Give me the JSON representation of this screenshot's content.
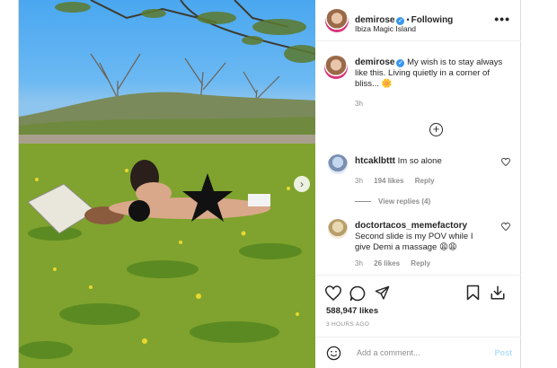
{
  "post": {
    "username": "demirose",
    "following_label": "Following",
    "location": "Ibiza Magic Island",
    "more_icon": "more-horizontal-icon"
  },
  "caption": {
    "username": "demirose",
    "text": "My wish is to stay always like this. Living quietly in a corner of bliss...",
    "emoji": "🌼",
    "time": "3h"
  },
  "comments": [
    {
      "username": "htcaklbttt",
      "text": "Im so alone",
      "time": "3h",
      "likes": "194 likes",
      "reply": "Reply",
      "view_replies": "View replies (4)"
    },
    {
      "username": "doctortacos_memefactory",
      "text": "Second slide is my POV while I give Demi a massage 😩😩",
      "time": "3h",
      "likes": "26 likes",
      "reply": "Reply"
    }
  ],
  "stats": {
    "likes": "588,947 likes",
    "time": "3 HOURS AGO"
  },
  "composer": {
    "placeholder": "Add a comment...",
    "post_label": "Post"
  },
  "colors": {
    "accent": "#3897f0",
    "post_disabled": "#b2dffc",
    "muted": "#8e8e8e",
    "text": "#262626"
  }
}
